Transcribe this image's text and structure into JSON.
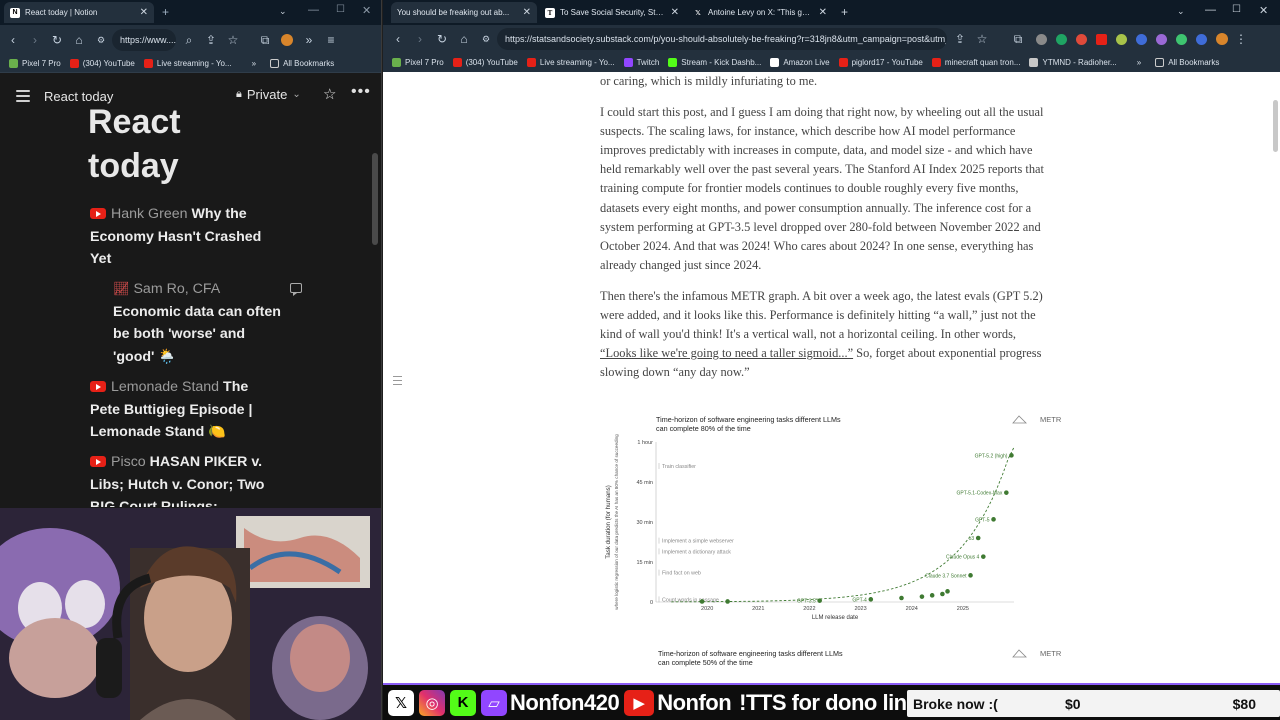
{
  "left_browser": {
    "tab_title": "React today | Notion",
    "url": "https://www....",
    "bookmarks": [
      "Pixel 7 Pro",
      "(304) YouTube",
      "Live streaming - Yo..."
    ],
    "all_bookmarks": "All Bookmarks"
  },
  "notion": {
    "header_title": "React today",
    "privacy": "Private",
    "page_title_line1": "React",
    "page_title_line2": "today",
    "items": [
      {
        "channel": "Hank Green",
        "title": "Why the Economy Hasn't Crashed Yet"
      },
      {
        "channel": "Sam Ro, CFA",
        "title": "Economic data can often be both 'worse' and 'good' 🌦️"
      },
      {
        "channel": "Lemonade Stand",
        "title": "The Pete Buttigieg Episode | Lemonade Stand 🍋"
      },
      {
        "channel": "Pisco",
        "title": "HASAN PIKER v. Libs; Hutch v. Conor; Two BIG Court Rulings;"
      }
    ]
  },
  "right_browser": {
    "tabs": [
      {
        "title": "You should be freaking out ab..."
      },
      {
        "title": "To Save Social Security, Stop S..."
      },
      {
        "title": "Antoine Levy on X: \"This graph..."
      }
    ],
    "url": "https://statsandsociety.substack.com/p/you-should-absolutely-be-freaking?r=318jn8&utm_campaign=post&utm_...",
    "bookmarks": [
      "Pixel 7 Pro",
      "(304) YouTube",
      "Live streaming - Yo...",
      "Twitch",
      "Stream - Kick Dashb...",
      "Amazon Live",
      "piglord17 - YouTube",
      "minecraft quan tron...",
      "YTMND - Radioher..."
    ],
    "all_bookmarks": "All Bookmarks"
  },
  "article": {
    "p0": "or caring, which is mildly infuriating to me.",
    "p1": "I could start this post, and I guess I am doing that right now, by wheeling out all the usual suspects. The scaling laws, for instance, which describe how AI model performance improves predictably with increases in compute, data, and model size - and which have held remarkably well over the past several years. The Stanford AI Index 2025 reports that training compute for frontier models continues to double roughly every five months, datasets every eight months, and power consumption annually. The inference cost for a system performing at GPT-3.5 level dropped over 280-fold between November 2022 and October 2024. And that was 2024! Who cares about 2024? In one sense, everything has already changed just since 2024.",
    "p2_a": "Then there's the infamous METR graph. A bit over a week ago, the latest evals (GPT 5.2) were added, and it looks like this. Performance is definitely hitting “a wall,” just not the kind of wall you'd think! It's a vertical wall, not a horizontal ceiling. In other words, ",
    "p2_link": "“Looks like we're going to need a taller sigmoid...”",
    "p2_b": " So, forget about exponential progress slowing down “any day now.”"
  },
  "chart_data": [
    {
      "type": "scatter",
      "title": "Time-horizon of software engineering tasks different LLMs can complete 80% of the time",
      "brand": "METR",
      "xlabel": "LLM release date",
      "ylabel": "Task duration (for humans)",
      "ylabel_sub": "where logistic regression of our data predicts the AI has an 80% chance of succeeding",
      "y_ticks": [
        "0",
        "15 min",
        "30 min",
        "45 min",
        "1 hour"
      ],
      "y_ticks_minutes": [
        0,
        15,
        30,
        45,
        60
      ],
      "x_ticks": [
        "2020",
        "2021",
        "2022",
        "2023",
        "2024",
        "2025"
      ],
      "x_ticks_year": [
        2020,
        2021,
        2022,
        2023,
        2024,
        2025
      ],
      "xlim": [
        2019.0,
        2026.0
      ],
      "ylim": [
        0,
        60
      ],
      "task_labels": [
        {
          "label": "Train classifier",
          "minutes": 51
        },
        {
          "label": "Implement a simple webserver",
          "minutes": 23
        },
        {
          "label": "Implement a dictionary attack",
          "minutes": 19
        },
        {
          "label": "Find fact on web",
          "minutes": 11
        },
        {
          "label": "Count words in passage",
          "minutes": 1
        }
      ],
      "points": [
        {
          "label": "",
          "x": 2019.9,
          "y": 0.2
        },
        {
          "label": "",
          "x": 2020.4,
          "y": 0.2
        },
        {
          "label": "GPT-3.5",
          "x": 2022.2,
          "y": 0.5
        },
        {
          "label": "GPT-4",
          "x": 2023.2,
          "y": 1.0
        },
        {
          "label": "",
          "x": 2023.8,
          "y": 1.5
        },
        {
          "label": "",
          "x": 2024.2,
          "y": 2.0
        },
        {
          "label": "",
          "x": 2024.4,
          "y": 2.5
        },
        {
          "label": "",
          "x": 2024.6,
          "y": 3.0
        },
        {
          "label": "",
          "x": 2024.7,
          "y": 4.0
        },
        {
          "label": "Claude 3.7 Sonnet",
          "x": 2025.15,
          "y": 10.0
        },
        {
          "label": "Claude Opus 4",
          "x": 2025.4,
          "y": 17.0
        },
        {
          "label": "o3",
          "x": 2025.3,
          "y": 24.0
        },
        {
          "label": "GPT-5",
          "x": 2025.6,
          "y": 31.0
        },
        {
          "label": "GPT-5.1-Codex-Max",
          "x": 2025.85,
          "y": 41.0
        },
        {
          "label": "GPT-5.2 (high)",
          "x": 2025.95,
          "y": 55.0
        }
      ],
      "trend": "exponential (dashed)"
    },
    {
      "type": "scatter",
      "title": "Time-horizon of software engineering tasks different LLMs can complete 50% of the time",
      "brand": "METR"
    }
  ],
  "streambar": {
    "x_handle": "Nonfon420",
    "yt_handle": "Nonfon",
    "tts": "!TTS for dono link",
    "goal_label": "Broke now :(",
    "goal_current": "$0",
    "goal_target": "$80",
    "goal_progress": 0.0
  },
  "colors": {
    "chart_green": "#3f7a32",
    "accent": "#8b5cf6"
  }
}
